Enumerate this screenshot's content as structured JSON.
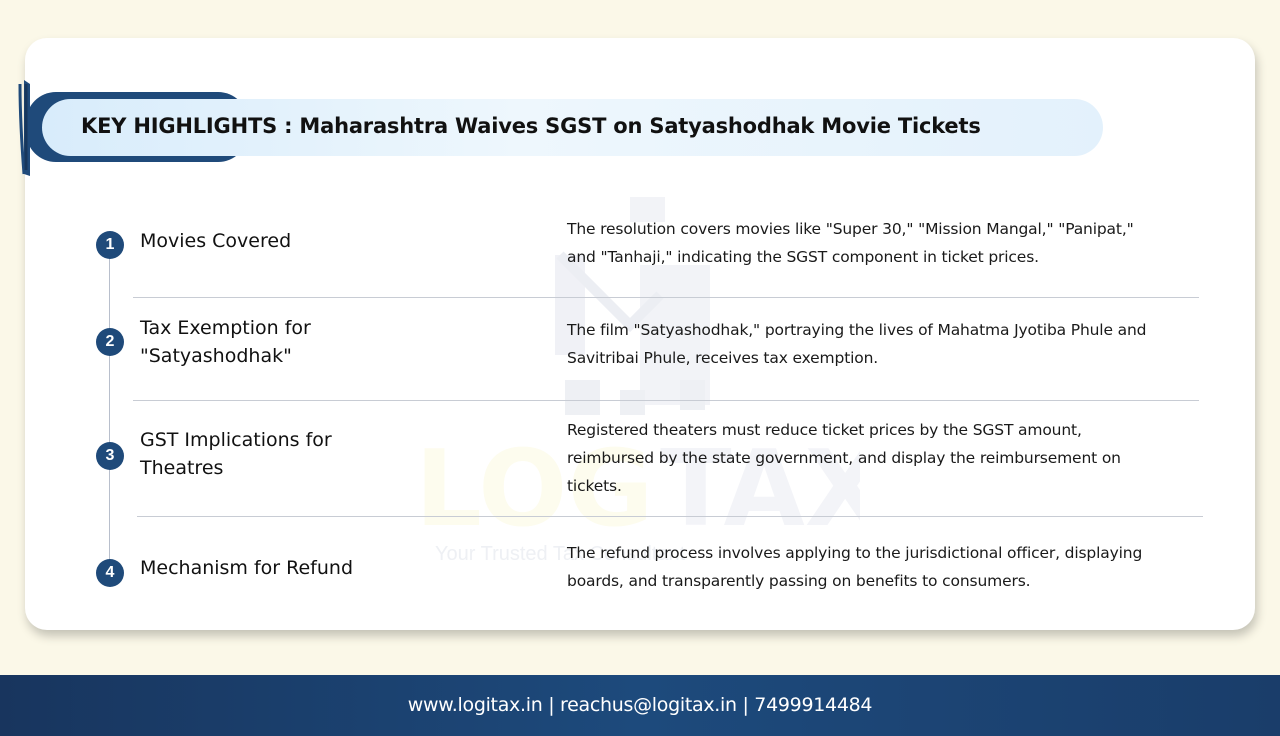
{
  "title": "KEY HIGHLIGHTS : Maharashtra Waives SGST on Satyashodhak Movie Tickets",
  "watermark": {
    "brand": "LOGITAX",
    "tagline": "Your Trusted Tax Consultant"
  },
  "items": [
    {
      "number": "1",
      "heading": "Movies Covered",
      "description": "The resolution covers movies like \"Super 30,\" \"Mission Mangal,\" \"Panipat,\" and \"Tanhaji,\" indicating the SGST component in ticket prices."
    },
    {
      "number": "2",
      "heading": "Tax Exemption for \"Satyashodhak\"",
      "description": "The film \"Satyashodhak,\" portraying the lives of Mahatma Jyotiba Phule and Savitribai Phule, receives tax exemption."
    },
    {
      "number": "3",
      "heading": "GST Implications for Theatres",
      "description": "Registered theaters must reduce ticket prices by the SGST amount, reimbursed by the state government, and display the reimbursement on tickets."
    },
    {
      "number": "4",
      "heading": "Mechanism for Refund",
      "description": "The refund process involves applying to the jurisdictional officer, displaying boards, and transparently passing on benefits to consumers."
    }
  ],
  "footer": {
    "text": "www.logitax.in | reachus@logitax.in |  7499914484"
  },
  "colors": {
    "accent": "#1f4a7a",
    "footer_bg": "#1d4a7c",
    "page_bg": "#fbf8e8"
  }
}
